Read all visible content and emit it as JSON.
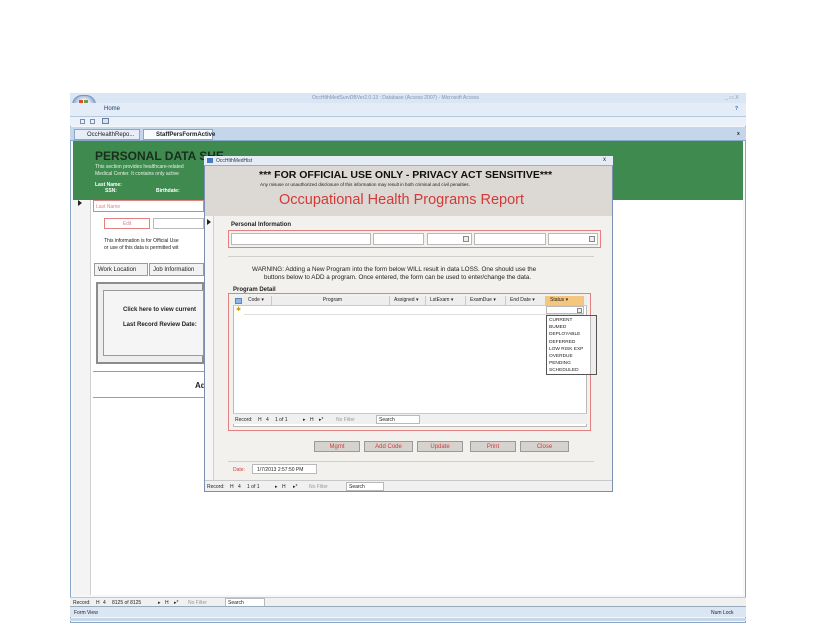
{
  "window": {
    "title": "OccHlthMedSurvDBVer2.0.13 : Database (Access 2007) - Microsoft Access",
    "controls": "_ ▭ X",
    "ribbon_tab": "Home",
    "help": "?",
    "close_x": "x"
  },
  "doc_tabs": [
    {
      "label": "OccHealthRepo..."
    },
    {
      "label": "StaffPersFormActive"
    }
  ],
  "main_form": {
    "heading": "PERSONAL DATA SHE",
    "desc_line1": "This section provides healthcare-related",
    "desc_line2": "Medical Center. It contains only active",
    "last_name_label": "Last Name:",
    "ssn_label": "SSN:",
    "birthdate_label": "Birthdate:",
    "last_name_value": "Last Name",
    "edit_value": "Edit",
    "notice_line1": "This information is for Official Use",
    "notice_line2": "or use of this data is permitted wit",
    "tab_work_location": "Work Location",
    "tab_job_information": "Job Information",
    "click_here": "Click here to view current",
    "last_review": "Last Record Review Date:",
    "add_button": "Ad"
  },
  "record_nav_main": {
    "label": "Record:",
    "first": "H",
    "prev": "4",
    "position": "8125 of 8125",
    "next": "▸",
    "last": "H",
    "new": "▸*",
    "filter": "No Filter",
    "search": "Search"
  },
  "status_bar": {
    "left": "Form View",
    "right": "Num Lock"
  },
  "dialog": {
    "title": "OccHlthMedHist",
    "close": "x",
    "official_use": "*** FOR OFFICIAL USE ONLY - PRIVACY ACT SENSITIVE***",
    "misuse_note": "Any misuse or unauthorized disclosure of this information may result in both criminal and civil penalties.",
    "report_title": "Occupational Health Programs Report",
    "personal_info_label": "Personal Information",
    "warning_line1": "WARNING:  Adding a New Program into the form below WILL result in data LOSS.  One should use the",
    "warning_line2": "buttons below to ADD a program.  Once entered, the form can be used to enter/change the data.",
    "program_detail_label": "Program Detail",
    "columns": [
      "Code",
      "Program",
      "Assigned",
      "LstExam",
      "ExamDue",
      "End Date",
      "Status"
    ],
    "new_row_marker": "✱",
    "status_options": [
      "CURRENT",
      "BUMED",
      "DEPLOYABLE",
      "DEFERRED",
      "LOW RISK EXP",
      "OVERDUE",
      "PENDING",
      "SCHEDULED"
    ],
    "subform_nav": {
      "label": "Record:",
      "first": "H",
      "prev": "4",
      "position": "1 of 1",
      "next": "▸",
      "last": "H",
      "new": "▸*",
      "filter": "No Filter",
      "search": "Search"
    },
    "buttons": {
      "mgmt": "Mgmt",
      "add_code": "Add Code",
      "update": "Update",
      "print": "Print",
      "close": "Close"
    },
    "date_label": "Date:",
    "date_value": "1/7/2013 2:57:50 PM",
    "bottom_nav": {
      "label": "Record:",
      "first": "H",
      "prev": "4",
      "position": "1 of 1",
      "next": "▸",
      "last": "H",
      "new": "▸*",
      "filter": "No Filter",
      "search": "Search"
    }
  },
  "colors": {
    "green_band": "#3f8a4e",
    "title_red": "#d23a3a",
    "status_header": "#f5c77e"
  }
}
